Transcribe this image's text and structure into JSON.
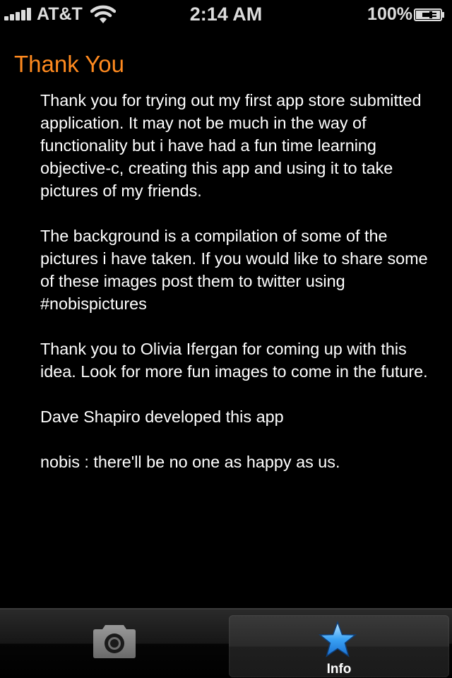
{
  "status_bar": {
    "carrier": "AT&T",
    "time": "2:14 AM",
    "battery": "100%",
    "icons": [
      "signal-bars-icon",
      "wifi-icon",
      "battery-charging-icon"
    ]
  },
  "page": {
    "title": "Thank You",
    "title_color": "#ff8a1f",
    "paragraphs": [
      "Thank you for trying out my first app store submitted application. It may not be much in the way of functionality but i have had a fun time learning objective-c, creating this app and using it to take pictures of my friends.",
      "The background is a compilation of some of the pictures i have taken. If you would like to share some of these images post them to twitter using #nobispictures",
      "Thank you to Olivia Ifergan for coming up with this idea. Look for more fun images to come in the future.",
      "Dave Shapiro developed this app",
      "nobis : there'll be no one as happy as us."
    ]
  },
  "tab_bar": {
    "tabs": [
      {
        "icon": "camera-icon",
        "label": "",
        "selected": false
      },
      {
        "icon": "star-icon",
        "label": "Info",
        "selected": true
      }
    ]
  }
}
